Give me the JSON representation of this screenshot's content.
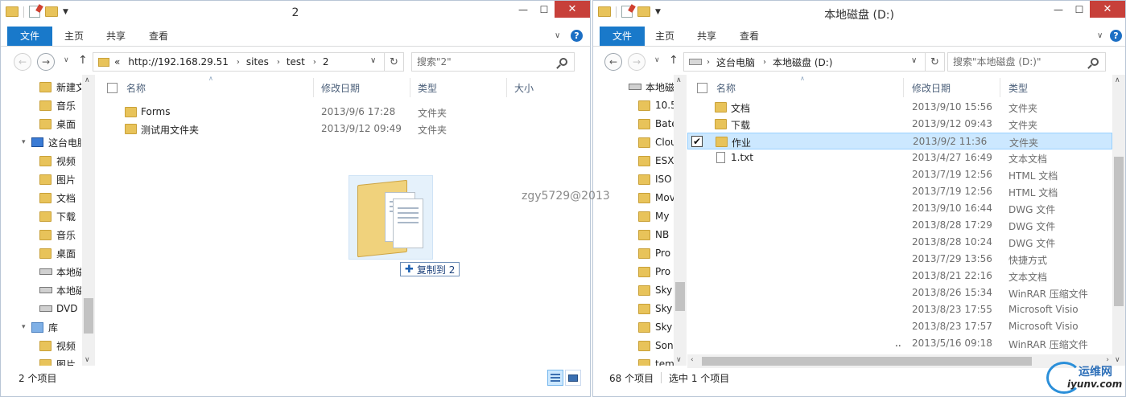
{
  "left": {
    "title": "2",
    "tabs": {
      "file": "文件",
      "home": "主页",
      "share": "共享",
      "view": "查看"
    },
    "address": {
      "crumbs": [
        "http://192.168.29.51",
        "sites",
        "test",
        "2"
      ],
      "overflow": "«"
    },
    "search_placeholder": "搜索\"2\"",
    "nav_items": [
      "新建文",
      "音乐",
      "桌面",
      "这台电脑",
      "视频",
      "图片",
      "文档",
      "下载",
      "音乐",
      "桌面",
      "本地磁",
      "本地磁",
      "DVD",
      "库",
      "视频",
      "图片"
    ],
    "columns": {
      "name": "名称",
      "date": "修改日期",
      "type": "类型",
      "size": "大小"
    },
    "rows": [
      {
        "name": "Forms",
        "date": "2013/9/6 17:28",
        "type": "文件夹"
      },
      {
        "name": "测试用文件夹",
        "date": "2013/9/12 09:49",
        "type": "文件夹"
      }
    ],
    "status": "2 个项目",
    "drag_tooltip": "复制到 2"
  },
  "right": {
    "title": "本地磁盘 (D:)",
    "tabs": {
      "file": "文件",
      "home": "主页",
      "share": "共享",
      "view": "查看"
    },
    "address": {
      "crumbs": [
        "这台电脑",
        "本地磁盘 (D:)"
      ]
    },
    "search_placeholder": "搜索\"本地磁盘 (D:)\"",
    "nav_items": [
      "本地磁",
      "10.5",
      "Bate",
      "Clou",
      "ESX",
      "ISO",
      "Mov",
      "My",
      "NB",
      "Pro",
      "Pro",
      "Sky",
      "Sky",
      "Sky",
      "Son",
      "tem"
    ],
    "columns": {
      "name": "名称",
      "date": "修改日期",
      "type": "类型"
    },
    "rows": [
      {
        "name": "文档",
        "date": "2013/9/10 15:56",
        "type": "文件夹",
        "kind": "folder"
      },
      {
        "name": "下载",
        "date": "2013/9/12 09:43",
        "type": "文件夹",
        "kind": "folder"
      },
      {
        "name": "作业",
        "date": "2013/9/2 11:36",
        "type": "文件夹",
        "kind": "folder",
        "selected": true
      },
      {
        "name": "1.txt",
        "date": "2013/4/27 16:49",
        "type": "文本文档",
        "kind": "file"
      },
      {
        "name": "",
        "date": "2013/7/19 12:56",
        "type": "HTML 文档",
        "kind": "none"
      },
      {
        "name": "",
        "date": "2013/7/19 12:56",
        "type": "HTML 文档",
        "kind": "none"
      },
      {
        "name": "",
        "date": "2013/9/10 16:44",
        "type": "DWG 文件",
        "kind": "none"
      },
      {
        "name": "",
        "date": "2013/8/28 17:29",
        "type": "DWG 文件",
        "kind": "none"
      },
      {
        "name": "",
        "date": "2013/8/28 10:24",
        "type": "DWG 文件",
        "kind": "none"
      },
      {
        "name": "",
        "date": "2013/7/29 13:56",
        "type": "快捷方式",
        "kind": "none"
      },
      {
        "name": "",
        "date": "2013/8/21 22:16",
        "type": "文本文档",
        "kind": "none"
      },
      {
        "name": "",
        "date": "2013/8/26 15:34",
        "type": "WinRAR 压缩文件",
        "kind": "none"
      },
      {
        "name": "",
        "date": "2013/8/23 17:55",
        "type": "Microsoft Visio",
        "kind": "none"
      },
      {
        "name": "",
        "date": "2013/8/23 17:57",
        "type": "Microsoft Visio",
        "kind": "none"
      },
      {
        "name": "..",
        "date": "2013/5/16 09:18",
        "type": "WinRAR 压缩文件",
        "kind": "none"
      }
    ],
    "status": "68 个项目",
    "status_selected": "选中 1 个项目"
  },
  "watermark": "zgy5729@2013",
  "logo": {
    "line1": "运维网",
    "line2": "iyunv.com"
  },
  "colors": {
    "ribbon_file": "#1979ca",
    "close_button": "#c7403a",
    "selection": "#cce8ff",
    "folder": "#e8c35a"
  }
}
